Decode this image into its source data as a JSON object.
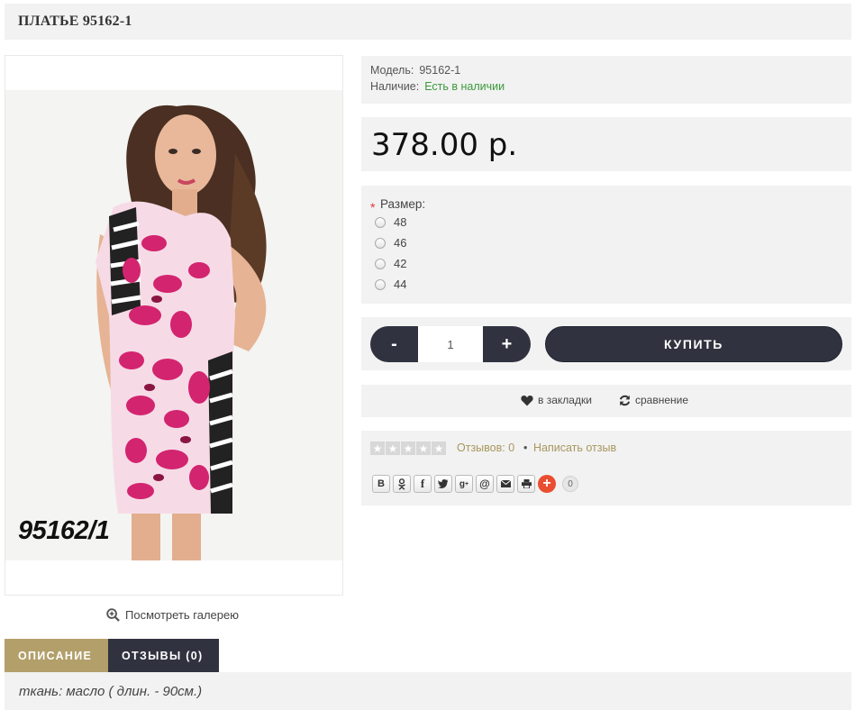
{
  "product": {
    "title": "ПЛАТЬЕ 95162-1",
    "image_caption": "95162/1",
    "gallery_link": "Посмотреть галерею"
  },
  "info": {
    "model_label": "Модель:",
    "model_value": "95162-1",
    "stock_label": "Наличие:",
    "stock_value": "Есть в наличии"
  },
  "price": "378.00 р.",
  "options": {
    "required_mark": "*",
    "size_label": "Размер:",
    "sizes": [
      "48",
      "46",
      "42",
      "44"
    ]
  },
  "buy": {
    "minus_label": "-",
    "quantity": "1",
    "plus_label": "+",
    "buy_label": "КУПИТЬ"
  },
  "actions": {
    "wishlist_label": "в закладки",
    "compare_label": "сравнение"
  },
  "rating": {
    "stars_filled": 0,
    "stars_total": 5,
    "reviews_label": "Отзывов: 0",
    "separator": "•",
    "write_review_label": "Написать отзыв"
  },
  "share": {
    "buttons": [
      "В",
      "ok",
      "f",
      "twitter",
      "g+",
      "@",
      "mail",
      "print"
    ],
    "count": "0"
  },
  "tabs": [
    {
      "label": "ОПИСАНИЕ",
      "active": true
    },
    {
      "label": "ОТЗЫВЫ (0)",
      "active": false
    }
  ],
  "description": "ткань: масло  ( длин. - 90см.)",
  "colors": {
    "panel_bg": "#f2f2f2",
    "dark": "#30333f",
    "gold": "#b29f6a",
    "in_stock": "#3a9a3a"
  }
}
